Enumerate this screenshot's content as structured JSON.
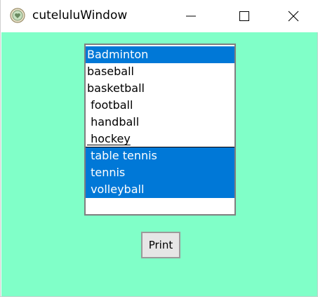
{
  "window": {
    "title": "cuteluluWindow",
    "icon": "heart-badge-icon",
    "controls": {
      "minimize": "minimize-icon",
      "maximize": "maximize-icon",
      "close": "close-icon"
    }
  },
  "colors": {
    "client_background": "#80ffc8",
    "selection": "#0078d7",
    "selection_text": "#ffffff"
  },
  "listbox": {
    "items": [
      {
        "label": "Badminton",
        "selected": true
      },
      {
        "label": "baseball",
        "selected": false
      },
      {
        "label": "basketball",
        "selected": false
      },
      {
        "label": " football",
        "selected": false
      },
      {
        "label": " handball",
        "selected": false
      },
      {
        "label": " hockey",
        "selected": false,
        "focused": true
      },
      {
        "label": " table tennis",
        "selected": true
      },
      {
        "label": " tennis",
        "selected": true
      },
      {
        "label": " volleyball",
        "selected": true
      }
    ]
  },
  "print_button": {
    "label": "Print"
  }
}
